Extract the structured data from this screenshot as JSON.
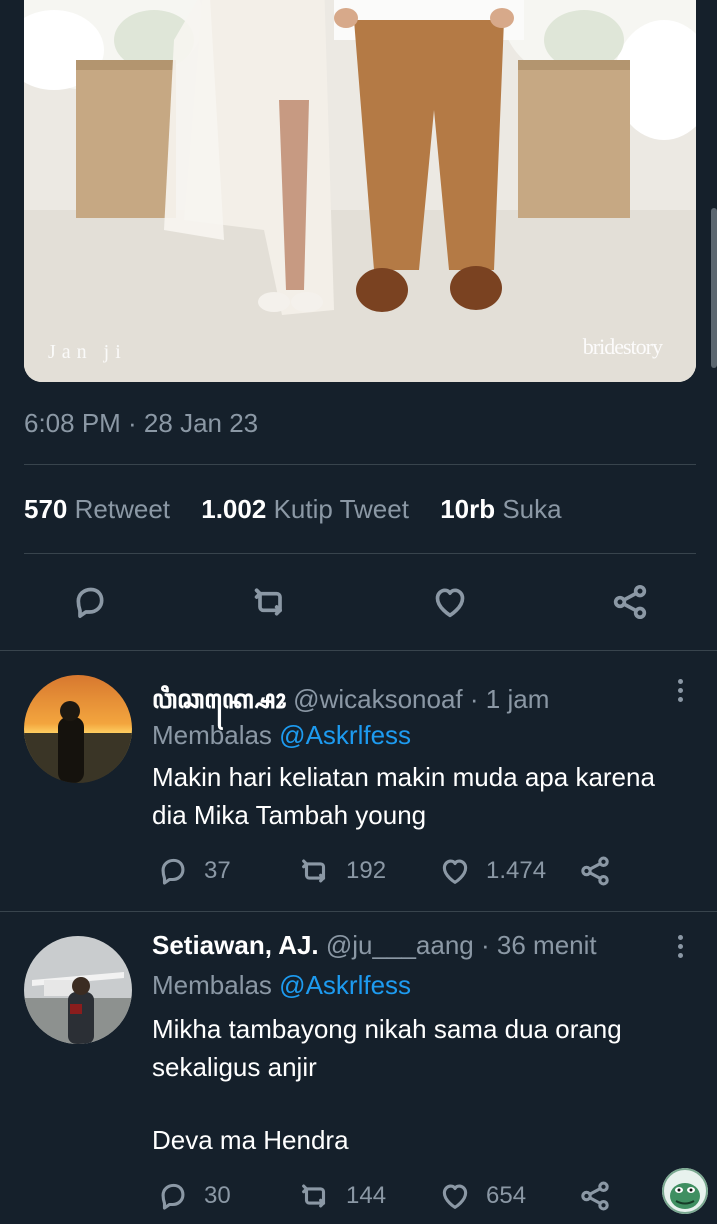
{
  "tweet": {
    "image": {
      "watermark_left": "Jan ji",
      "watermark_right": "bridestory"
    },
    "timestamp": "6:08 PM · 28 Jan 23",
    "stats": {
      "retweets": {
        "count": "570",
        "label": "Retweet"
      },
      "quotes": {
        "count": "1.002",
        "label": "Kutip Tweet"
      },
      "likes": {
        "count": "10rb",
        "label": "Suka"
      }
    },
    "actions": [
      "reply-icon",
      "retweet-icon",
      "like-icon",
      "share-icon"
    ]
  },
  "replies": [
    {
      "name": "ꦮꦶꦕꦏ꧀ꦱꦺꦴ",
      "handle": "@wicaksonoaf",
      "dot": "·",
      "time": "1 jam",
      "replying_label": "Membalas",
      "replying_to": "@Askrlfess",
      "text": "Makin hari keliatan makin muda apa karena dia Mika Tambah young",
      "counts": {
        "replies": "37",
        "retweets": "192",
        "likes": "1.474"
      }
    },
    {
      "name": "Setiawan, AJ.",
      "handle": "@ju___aang",
      "dot": "·",
      "time": "36 menit",
      "replying_label": "Membalas",
      "replying_to": "@Askrlfess",
      "text": "Mikha tambayong nikah sama dua orang sekaligus anjir",
      "text_extra": "Deva ma Hendra",
      "counts": {
        "replies": "30",
        "retweets": "144",
        "likes": "654"
      }
    }
  ],
  "colors": {
    "background": "#15202b",
    "divider": "#38444d",
    "secondary_text": "#8b98a5",
    "link": "#1d9bf0"
  }
}
